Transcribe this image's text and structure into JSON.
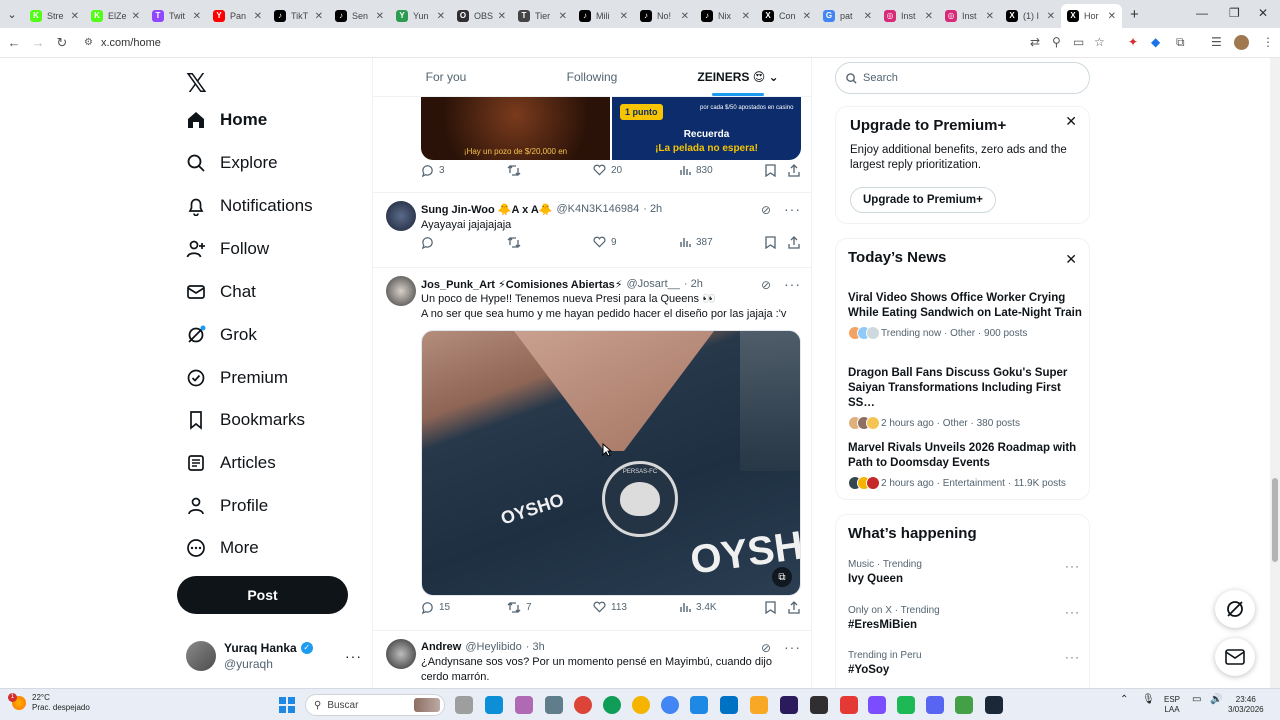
{
  "browser": {
    "tabs": [
      {
        "label": "Stre",
        "fav": "K",
        "color": "#53fc18"
      },
      {
        "label": "ElZe",
        "fav": "K",
        "color": "#53fc18"
      },
      {
        "label": "Twit",
        "fav": "T",
        "color": "#9146ff"
      },
      {
        "label": "Pan",
        "fav": "Y",
        "color": "#ff0000"
      },
      {
        "label": "TikT",
        "fav": "♪",
        "color": "#000000"
      },
      {
        "label": "Sen",
        "fav": "♪",
        "color": "#000000"
      },
      {
        "label": "Yun",
        "fav": "Y",
        "color": "#2e9b52"
      },
      {
        "label": "OBS",
        "fav": "O",
        "color": "#302e31"
      },
      {
        "label": "Tier",
        "fav": "T",
        "color": "#444444"
      },
      {
        "label": "Mili",
        "fav": "♪",
        "color": "#000000"
      },
      {
        "label": "No!",
        "fav": "♪",
        "color": "#000000"
      },
      {
        "label": "Nix",
        "fav": "♪",
        "color": "#000000"
      },
      {
        "label": "Con",
        "fav": "X",
        "color": "#000000"
      },
      {
        "label": "pat",
        "fav": "G",
        "color": "#4285f4"
      },
      {
        "label": "Inst",
        "fav": "◎",
        "color": "#d62976"
      },
      {
        "label": "Inst",
        "fav": "◎",
        "color": "#d62976"
      },
      {
        "label": "(1) I",
        "fav": "X",
        "color": "#000000"
      },
      {
        "label": "Hor",
        "fav": "X",
        "color": "#000000",
        "active": true
      }
    ],
    "url": "x.com/home"
  },
  "nav": {
    "items": [
      {
        "label": "Home",
        "icon": "home-icon"
      },
      {
        "label": "Explore",
        "icon": "search-icon"
      },
      {
        "label": "Notifications",
        "icon": "bell-icon"
      },
      {
        "label": "Follow",
        "icon": "person-add-icon"
      },
      {
        "label": "Chat",
        "icon": "mail-icon"
      },
      {
        "label": "Grok",
        "icon": "grok-icon"
      },
      {
        "label": "Premium",
        "icon": "verified-icon"
      },
      {
        "label": "Bookmarks",
        "icon": "bookmark-icon"
      },
      {
        "label": "Articles",
        "icon": "articles-icon"
      },
      {
        "label": "Profile",
        "icon": "person-icon"
      },
      {
        "label": "More",
        "icon": "more-circle-icon"
      }
    ],
    "post_label": "Post",
    "account": {
      "name": "Yuraq Hanka",
      "handle": "@yuraqh"
    }
  },
  "feed": {
    "tabs": [
      "For you",
      "Following",
      "ZEINERS 😍"
    ],
    "ad": {
      "left_text": "¡Hay un pozo de $/20,000 en",
      "pill": "1 punto",
      "small": "por cada $/50 apostados en casino",
      "line1": "Recuerda",
      "line2": "¡La pelada no espera!"
    },
    "ad_actions": {
      "replies": "3",
      "reposts": "",
      "likes": "20",
      "views": "830"
    },
    "tweets": [
      {
        "name": "Sung Jin-Woo 🐥A x A🐥",
        "handle": "@K4N3K146984",
        "time": "· 2h",
        "text": "Ayayayai jajajajaja",
        "actions": {
          "replies": "",
          "reposts": "",
          "likes": "9",
          "views": "387"
        }
      },
      {
        "name": "Jos_Punk_Art ⚡Comisiones Abiertas⚡",
        "handle": "@Josart__",
        "time": "· 2h",
        "text1": "Un poco de Hype!! Tenemos nueva Presi para la Queens 👀",
        "text2": "A no ser que sea humo y me hayan pedido hacer el diseño por las  jajaja :'v",
        "media_text1": "OYSHO",
        "media_text2": "OYSHO",
        "crest_text": "PERSAS-FC",
        "actions": {
          "replies": "15",
          "reposts": "7",
          "likes": "113",
          "views": "3.4K"
        }
      },
      {
        "name": "Andrew",
        "handle": "@Heylibido",
        "time": "· 3h",
        "text": "¿Andynsane sos vos? Por un momento pensé en Mayimbú, cuando dijo cerdo marrón."
      }
    ]
  },
  "sidebar": {
    "search_placeholder": "Search",
    "premium": {
      "title": "Upgrade to Premium+",
      "body": "Enjoy additional benefits, zero ads and the largest reply prioritization.",
      "button": "Upgrade to Premium+"
    },
    "news_title": "Today’s News",
    "news": [
      {
        "title": "Viral Video Shows Office Worker Crying While Eating Sandwich on Late-Night Train",
        "meta": "Trending now · Other · 900 posts"
      },
      {
        "title": "Dragon Ball Fans Discuss Goku's Super Saiyan Transformations Including First SS…",
        "meta": "2 hours ago · Other · 380 posts"
      },
      {
        "title": "Marvel Rivals Unveils 2026 Roadmap with Path to Doomsday Events",
        "meta": "2 hours ago · Entertainment · 11.9K posts"
      }
    ],
    "happening_title": "What’s happening",
    "trends": [
      {
        "context": "Music · Trending",
        "name": "Ivy Queen"
      },
      {
        "context": "Only on X · Trending",
        "name": "#EresMiBien"
      },
      {
        "context": "Trending in Peru",
        "name": "#YoSoy"
      }
    ]
  },
  "taskbar": {
    "weather_temp": "22°C",
    "weather_desc": "Prac. despejado",
    "weather_badge": "1",
    "search_label": "Buscar",
    "lang1": "ESP",
    "lang2": "LAA",
    "time": "23:46",
    "date": "3/03/2026"
  }
}
